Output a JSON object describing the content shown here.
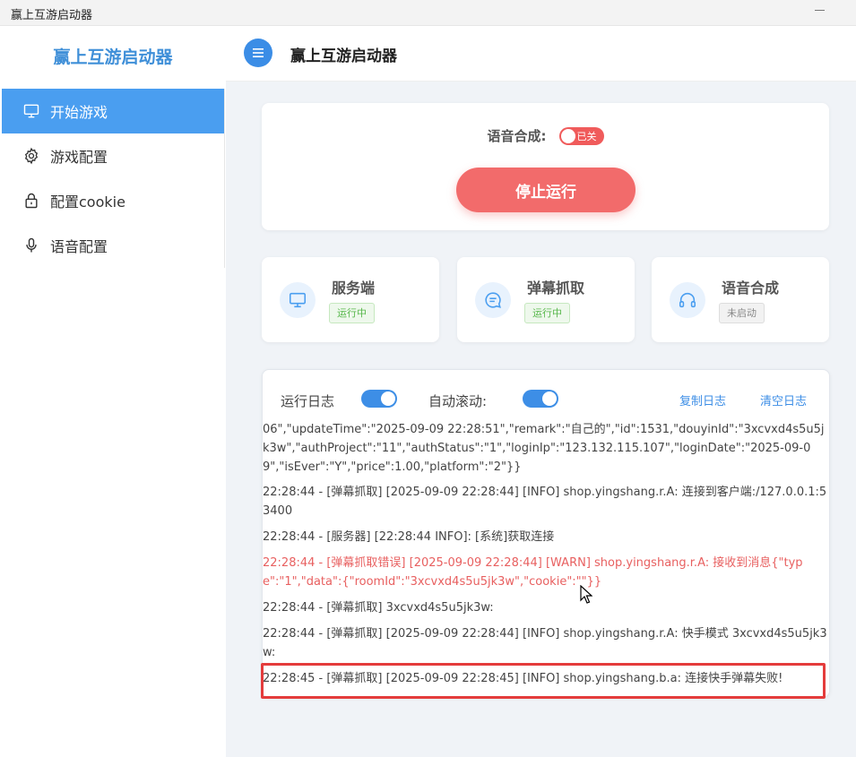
{
  "window": {
    "title": "赢上互游启动器"
  },
  "sidebar": {
    "brand": "赢上互游启动器",
    "items": [
      {
        "label": "开始游戏",
        "icon": "monitor-icon",
        "active": true
      },
      {
        "label": "游戏配置",
        "icon": "gear-icon",
        "active": false
      },
      {
        "label": "配置cookie",
        "icon": "lock-icon",
        "active": false
      },
      {
        "label": "语音配置",
        "icon": "microphone-icon",
        "active": false
      }
    ]
  },
  "header": {
    "title": "赢上互游启动器"
  },
  "control": {
    "voice_label": "语音合成:",
    "voice_switch_label": "已关",
    "stop_button": "停止运行"
  },
  "status_cards": [
    {
      "name": "服务端",
      "status": "运行中",
      "icon": "monitor-icon"
    },
    {
      "name": "弹幕抓取",
      "status": "运行中",
      "icon": "chat-icon"
    },
    {
      "name": "语音合成",
      "status": "未启动",
      "icon": "headphones-icon"
    }
  ],
  "log": {
    "title": "运行日志",
    "auto_scroll_label": "自动滚动:",
    "copy_label": "复制日志",
    "clear_label": "清空日志",
    "entries": [
      {
        "text": "06\",\"updateTime\":\"2025-09-09 22:28:51\",\"remark\":\"自己的\",\"id\":1531,\"douyinId\":\"3xcvxd4s5u5jk3w\",\"authProject\":\"11\",\"authStatus\":\"1\",\"loginIp\":\"123.132.115.107\",\"loginDate\":\"2025-09-09\",\"isEver\":\"Y\",\"price\":1.00,\"platform\":\"2\"}}",
        "level": "info"
      },
      {
        "text": "22:28:44 - [弹幕抓取] [2025-09-09 22:28:44] [INFO] shop.yingshang.r.A: 连接到客户端:/127.0.0.1:53400",
        "level": "info"
      },
      {
        "text": "22:28:44 - [服务器] [22:28:44 INFO]: [系统]获取连接",
        "level": "info"
      },
      {
        "text": "22:28:44 - [弹幕抓取错误] [2025-09-09 22:28:44] [WARN] shop.yingshang.r.A: 接收到消息{\"type\":\"1\",\"data\":{\"roomId\":\"3xcvxd4s5u5jk3w\",\"cookie\":\"\"}}",
        "level": "warn"
      },
      {
        "text": "22:28:44 - [弹幕抓取] 3xcvxd4s5u5jk3w:",
        "level": "info"
      },
      {
        "text": "22:28:44 - [弹幕抓取] [2025-09-09 22:28:44] [INFO] shop.yingshang.r.A: 快手模式 3xcvxd4s5u5jk3w:",
        "level": "info"
      },
      {
        "text": "22:28:45 - [弹幕抓取] [2025-09-09 22:28:45] [INFO] shop.yingshang.b.a: 连接快手弹幕失败!",
        "level": "info"
      }
    ]
  },
  "colors": {
    "accent": "#4a9ef0",
    "brand_text": "#3f8fd8",
    "danger": "#f26b6b",
    "success": "#57b74a",
    "warn_text": "#e86060",
    "highlight_border": "#e43c3c"
  }
}
